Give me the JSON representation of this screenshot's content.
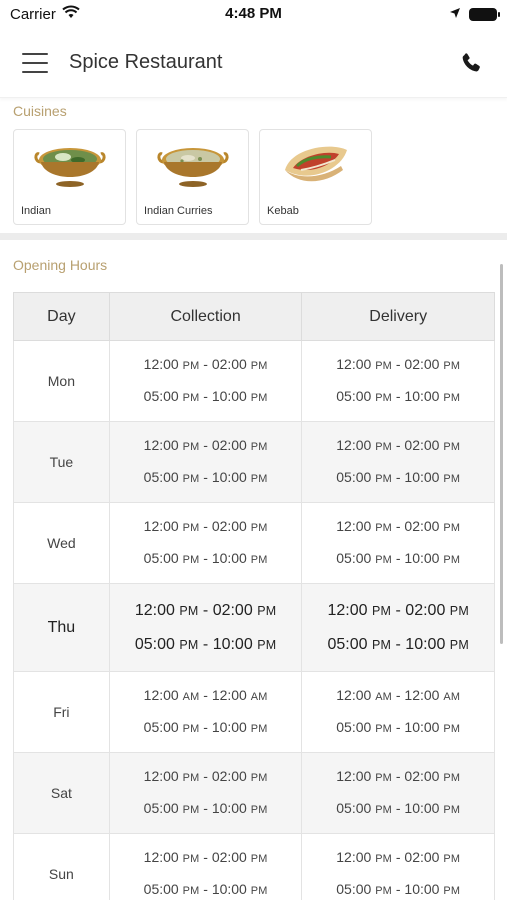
{
  "status_bar": {
    "carrier": "Carrier",
    "time": "4:48 PM"
  },
  "header": {
    "title": "Spice Restaurant",
    "menu_icon": "hamburger-icon",
    "phone_icon": "phone-icon"
  },
  "cuisines": {
    "label": "Cuisines",
    "items": [
      {
        "name": "Indian"
      },
      {
        "name": "Indian Curries"
      },
      {
        "name": "Kebab"
      }
    ]
  },
  "opening_hours": {
    "label": "Opening Hours",
    "columns": [
      "Day",
      "Collection",
      "Delivery"
    ],
    "rows": [
      {
        "day": "Mon",
        "collection": [
          [
            "12:00",
            "PM",
            "02:00",
            "PM"
          ],
          [
            "05:00",
            "PM",
            "10:00",
            "PM"
          ]
        ],
        "delivery": [
          [
            "12:00",
            "PM",
            "02:00",
            "PM"
          ],
          [
            "05:00",
            "PM",
            "10:00",
            "PM"
          ]
        ]
      },
      {
        "day": "Tue",
        "collection": [
          [
            "12:00",
            "PM",
            "02:00",
            "PM"
          ],
          [
            "05:00",
            "PM",
            "10:00",
            "PM"
          ]
        ],
        "delivery": [
          [
            "12:00",
            "PM",
            "02:00",
            "PM"
          ],
          [
            "05:00",
            "PM",
            "10:00",
            "PM"
          ]
        ]
      },
      {
        "day": "Wed",
        "collection": [
          [
            "12:00",
            "PM",
            "02:00",
            "PM"
          ],
          [
            "05:00",
            "PM",
            "10:00",
            "PM"
          ]
        ],
        "delivery": [
          [
            "12:00",
            "PM",
            "02:00",
            "PM"
          ],
          [
            "05:00",
            "PM",
            "10:00",
            "PM"
          ]
        ]
      },
      {
        "day": "Thu",
        "today": true,
        "collection": [
          [
            "12:00",
            "PM",
            "02:00",
            "PM"
          ],
          [
            "05:00",
            "PM",
            "10:00",
            "PM"
          ]
        ],
        "delivery": [
          [
            "12:00",
            "PM",
            "02:00",
            "PM"
          ],
          [
            "05:00",
            "PM",
            "10:00",
            "PM"
          ]
        ]
      },
      {
        "day": "Fri",
        "collection": [
          [
            "12:00",
            "AM",
            "12:00",
            "AM"
          ],
          [
            "05:00",
            "PM",
            "10:00",
            "PM"
          ]
        ],
        "delivery": [
          [
            "12:00",
            "AM",
            "12:00",
            "AM"
          ],
          [
            "05:00",
            "PM",
            "10:00",
            "PM"
          ]
        ]
      },
      {
        "day": "Sat",
        "collection": [
          [
            "12:00",
            "PM",
            "02:00",
            "PM"
          ],
          [
            "05:00",
            "PM",
            "10:00",
            "PM"
          ]
        ],
        "delivery": [
          [
            "12:00",
            "PM",
            "02:00",
            "PM"
          ],
          [
            "05:00",
            "PM",
            "10:00",
            "PM"
          ]
        ]
      },
      {
        "day": "Sun",
        "collection": [
          [
            "12:00",
            "PM",
            "02:00",
            "PM"
          ],
          [
            "05:00",
            "PM",
            "10:00",
            "PM"
          ]
        ],
        "delivery": [
          [
            "12:00",
            "PM",
            "02:00",
            "PM"
          ],
          [
            "05:00",
            "PM",
            "10:00",
            "PM"
          ]
        ]
      }
    ]
  },
  "colors": {
    "accent_label": "#b8a070",
    "header_bg": "#ffffff",
    "table_header_bg": "#efefef"
  }
}
